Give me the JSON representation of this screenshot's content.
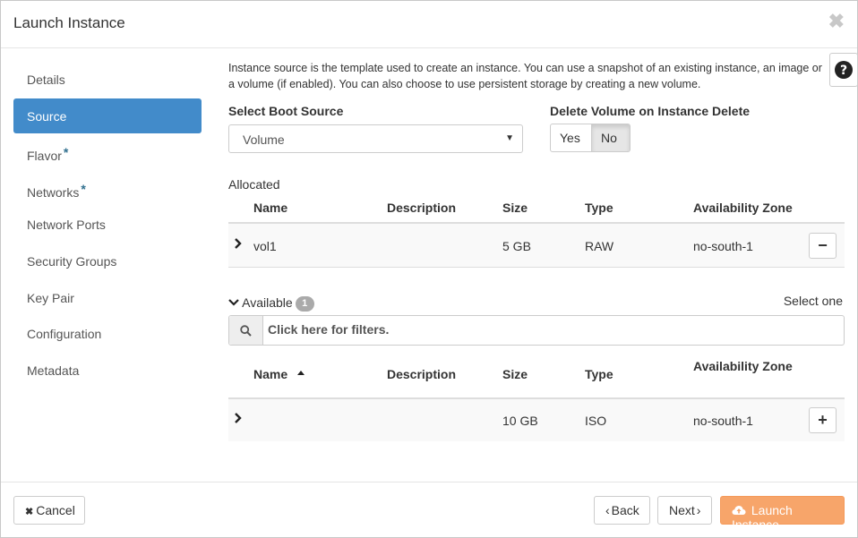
{
  "dialog": {
    "title": "Launch Instance",
    "close_glyph": "✖"
  },
  "sidebar": {
    "items": [
      {
        "label": "Details",
        "required": false,
        "active": false
      },
      {
        "label": "Source",
        "required": false,
        "active": true
      },
      {
        "label": "Flavor",
        "required": true,
        "active": false
      },
      {
        "label": "Networks",
        "required": true,
        "active": false
      },
      {
        "label": "Network Ports",
        "required": false,
        "active": false
      },
      {
        "label": "Security Groups",
        "required": false,
        "active": false
      },
      {
        "label": "Key Pair",
        "required": false,
        "active": false
      },
      {
        "label": "Configuration",
        "required": false,
        "active": false
      },
      {
        "label": "Metadata",
        "required": false,
        "active": false
      }
    ],
    "required_mark": "*"
  },
  "source": {
    "help_text": "Instance source is the template used to create an instance. You can use a snapshot of an existing instance, an image or a volume (if enabled). You can also choose to use persistent storage by creating a new volume.",
    "boot_source_label": "Select Boot Source",
    "boot_source_value": "Volume",
    "delete_volume_label": "Delete Volume on Instance Delete",
    "delete_yes": "Yes",
    "delete_no": "No",
    "delete_selected": "No"
  },
  "allocated": {
    "label": "Allocated",
    "columns": [
      "Name",
      "Description",
      "Size",
      "Type",
      "Availability Zone"
    ],
    "rows": [
      {
        "name": "vol1",
        "description": "",
        "size": "5 GB",
        "type": "RAW",
        "zone": "no-south-1",
        "action": "−"
      }
    ]
  },
  "available": {
    "label": "Available",
    "count": "1",
    "select_hint": "Select one",
    "filter_placeholder": "Click here for filters.",
    "columns": [
      "Name",
      "Description",
      "Size",
      "Type",
      "Availability Zone"
    ],
    "sort_column": "Name",
    "rows": [
      {
        "name": "",
        "description": "",
        "size": "10 GB",
        "type": "ISO",
        "zone": "no-south-1",
        "action": "+"
      }
    ]
  },
  "footer": {
    "cancel": "Cancel",
    "back": "Back",
    "next": "Next",
    "launch": "Launch Instance"
  },
  "colors": {
    "active_nav": "#428bca",
    "launch_button": "#f7a56a",
    "required_mark": "#31708f"
  }
}
